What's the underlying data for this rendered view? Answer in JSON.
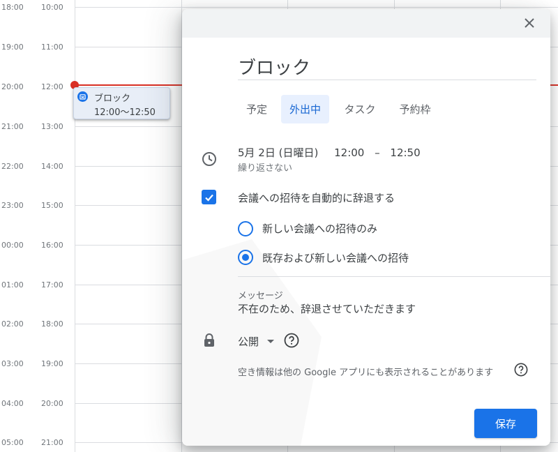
{
  "calendar": {
    "primary_times": [
      "18:00",
      "19:00",
      "20:00",
      "21:00",
      "22:00",
      "23:00",
      "00:00",
      "01:00",
      "02:00",
      "03:00",
      "04:00",
      "05:00"
    ],
    "secondary_times": [
      "10:00",
      "11:00",
      "12:00",
      "13:00",
      "14:00",
      "15:00",
      "16:00",
      "17:00",
      "18:00",
      "19:00",
      "20:00",
      "21:00"
    ],
    "event": {
      "title": "ブロック",
      "time": "12:00〜12:50"
    },
    "colors": {
      "now_line": "#d93025",
      "event_bg": "#e8eef7",
      "accent": "#1a73e8"
    }
  },
  "dialog": {
    "title": "ブロック",
    "tabs": [
      {
        "label": "予定",
        "active": false
      },
      {
        "label": "外出中",
        "active": true
      },
      {
        "label": "タスク",
        "active": false
      },
      {
        "label": "予約枠",
        "active": false
      }
    ],
    "datetime": {
      "date": "5月 2日 (日曜日)",
      "start": "12:00",
      "dash": "–",
      "end": "12:50"
    },
    "recurrence": "繰り返さない",
    "auto_decline": {
      "label": "会議への招待を自動的に辞退する",
      "checked": true
    },
    "decline_options": [
      {
        "label": "新しい会議への招待のみ",
        "checked": false
      },
      {
        "label": "既存および新しい会議への招待",
        "checked": true
      }
    ],
    "message": {
      "label": "メッセージ",
      "text": "不在のため、辞退させていただきます"
    },
    "visibility": {
      "label": "公開"
    },
    "info_text": "空き情報は他の Google アプリにも表示されることがあります",
    "save_label": "保存",
    "icons": {
      "close": "close-icon",
      "clock": "clock-icon",
      "checkbox": "checkbox-checked-icon",
      "lock": "lock-icon",
      "dropdown": "dropdown-caret-icon",
      "help": "help-icon"
    }
  }
}
